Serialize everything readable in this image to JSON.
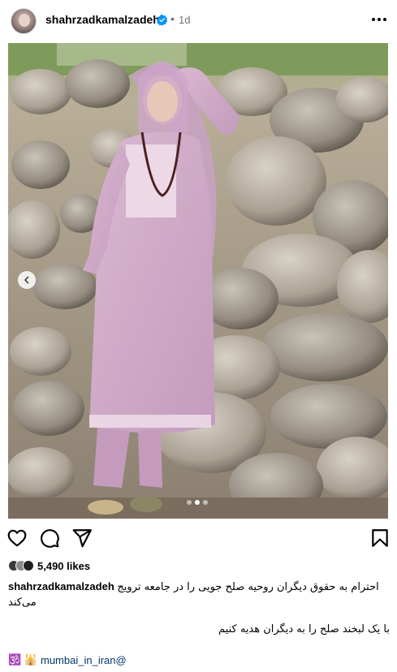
{
  "post": {
    "username": "shahrzadkamalzadeh",
    "time": "1d",
    "separator": "•"
  },
  "icons": {
    "verified": "verified-badge-icon",
    "more": "more-options-icon",
    "like": "heart-icon",
    "comment": "comment-icon",
    "share": "share-icon",
    "save": "bookmark-icon",
    "prev": "chevron-left-icon"
  },
  "likes": {
    "count_text": "5,490 likes"
  },
  "caption": {
    "username": "shahrzadkamalzadeh",
    "line1": "احترام به حقوق دیگران روحیه صلح جویی را در جامعه ترویج می‌کند",
    "line2": "با یک لبخند صلح را به دیگران هدیه کنیم",
    "tag_prefix": "🕉️ 🕌",
    "tag": "mumbai_in_iran@"
  },
  "carousel": {
    "current": 2,
    "total": 3
  },
  "colors": {
    "accent": "#0095f6",
    "link": "#00376b",
    "secondary_text": "#737373"
  }
}
